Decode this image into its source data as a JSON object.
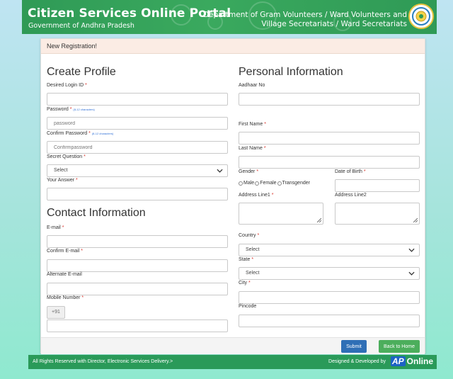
{
  "header": {
    "portal_title": "Citizen Services Online Portal",
    "portal_subtitle": "Government of Andhra Pradesh",
    "dept_line1": "Department of Gram Volunteers / Ward Volunteers and",
    "dept_line2": "Village Secretariats / Ward Secretariats"
  },
  "card": {
    "heading": "New Registration!"
  },
  "create_profile": {
    "title": "Create Profile",
    "login_id_label": "Desired Login ID",
    "password_label": "Password",
    "password_hint": "(8-12 characters)",
    "password_placeholder": "password",
    "confirm_password_label": "Confirm Password",
    "confirm_password_hint": "(8-12 characters)",
    "confirm_password_placeholder": "Confirmpassword",
    "secret_question_label": "Secret Question",
    "secret_question_value": "Select",
    "your_answer_label": "Your Answer"
  },
  "contact": {
    "title": "Contact Information",
    "email_label": "E-mail",
    "confirm_email_label": "Confirm E-mail",
    "alt_email_label": "Alternate E-mail",
    "mobile_label": "Mobile Number",
    "mobile_prefix": "+91"
  },
  "personal": {
    "title": "Personal Information",
    "aadhaar_label": "Aadhaar No",
    "first_name_label": "First Name",
    "last_name_label": "Last Name",
    "gender_label": "Gender",
    "gender_options": [
      "Male",
      "Female",
      "Transgender"
    ],
    "dob_label": "Date of Birth",
    "address1_label": "Address Line1",
    "address2_label": "Address Line2",
    "country_label": "Country",
    "country_value": "Select",
    "state_label": "State",
    "state_value": "Select",
    "city_label": "City",
    "pincode_label": "Pincode"
  },
  "actions": {
    "submit": "Submit",
    "back_home": "Back to Home"
  },
  "footer": {
    "rights": "All Rights Reserved with Director, Electronic Services Delivery.>",
    "designed": "Designed & Developed by",
    "logo_ap": "AP",
    "logo_online": "Online"
  },
  "colors": {
    "header_green": "#2f9a56",
    "submit_blue": "#2f6fb6",
    "home_green": "#4cae5c",
    "required_red": "#d9342b"
  }
}
